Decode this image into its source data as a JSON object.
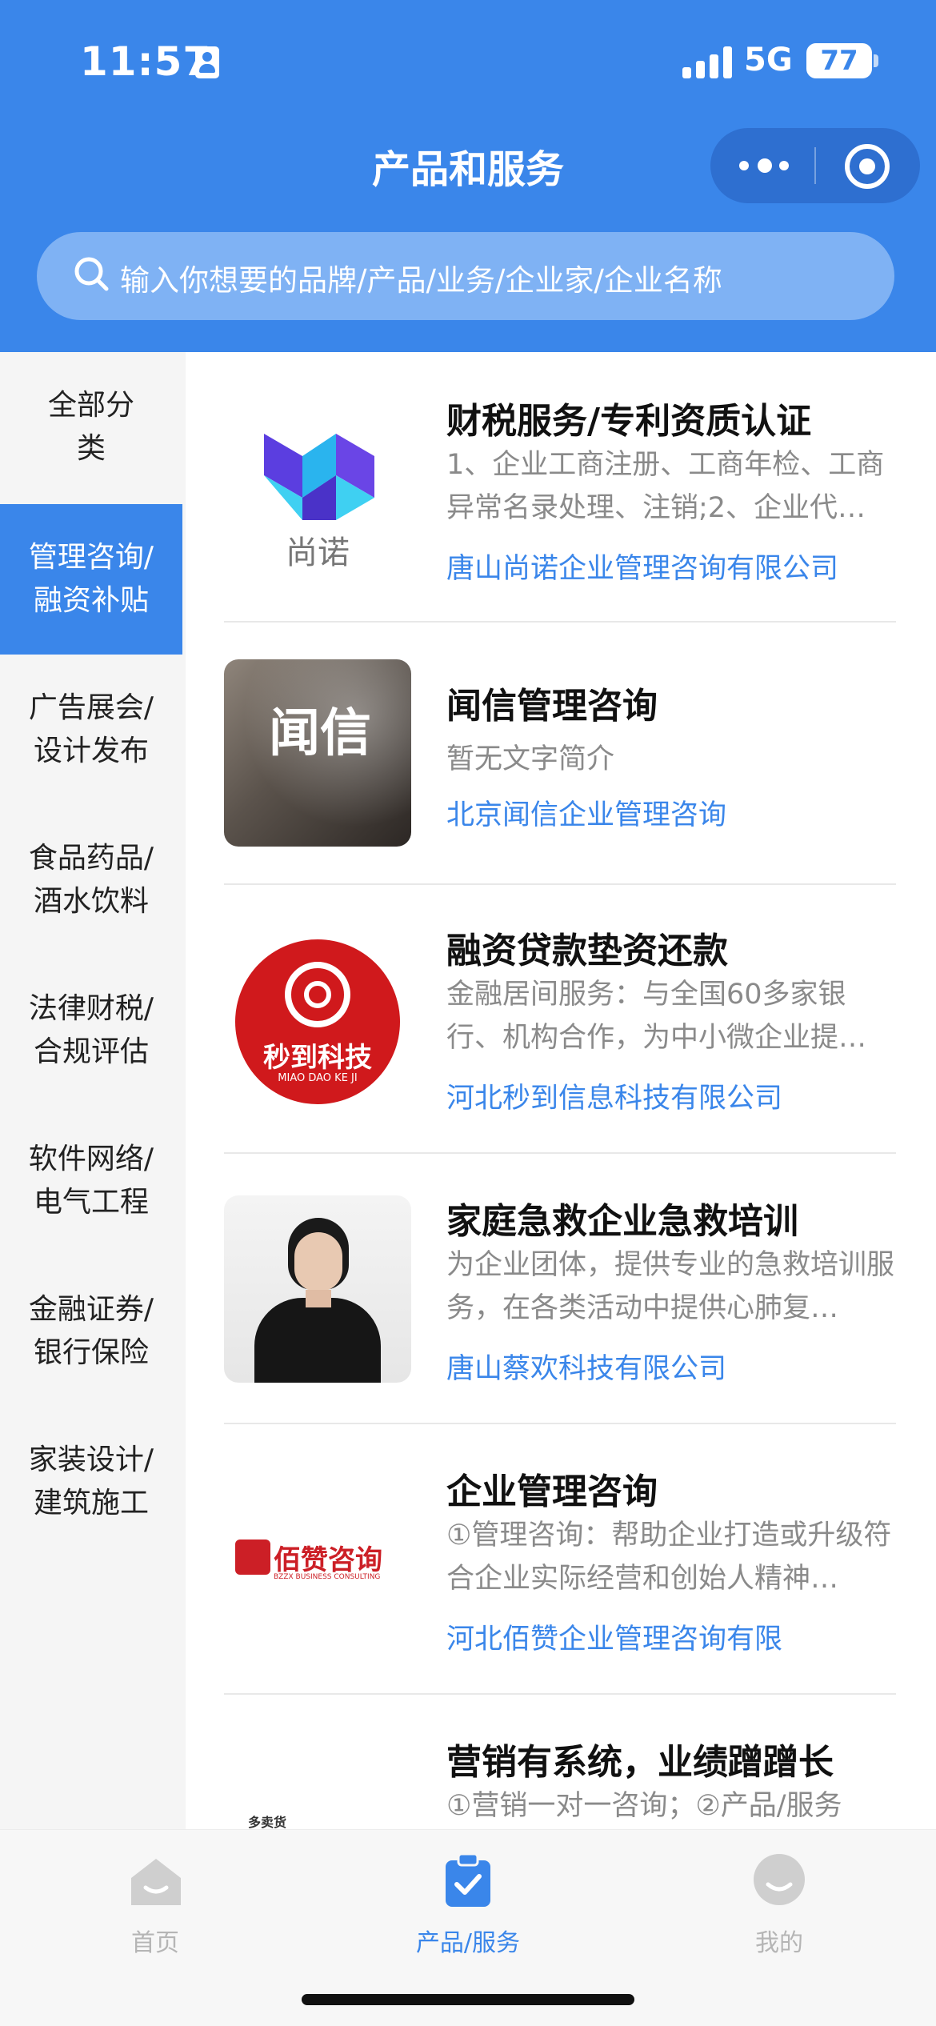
{
  "status_bar": {
    "time": "11:57",
    "network": "5G",
    "battery": "77"
  },
  "nav": {
    "title": "产品和服务"
  },
  "search": {
    "placeholder": "输入你想要的品牌/产品/业务/企业家/企业名称"
  },
  "sidebar": {
    "items": [
      {
        "label": "全部分类",
        "active": false
      },
      {
        "label": "管理咨询/融资补贴",
        "active": true
      },
      {
        "label": "广告展会/设计发布",
        "active": false
      },
      {
        "label": "食品药品/酒水饮料",
        "active": false
      },
      {
        "label": "法律财税/合规评估",
        "active": false
      },
      {
        "label": "软件网络/电气工程",
        "active": false
      },
      {
        "label": "金融证券/银行保险",
        "active": false
      },
      {
        "label": "家装设计/建筑施工",
        "active": false
      }
    ]
  },
  "products": [
    {
      "title": "财税服务/专利资质认证",
      "desc": "1、企业工商注册、工商年检、工商异常名录处理、注销;2、企业代…",
      "company": "唐山尚诺企业管理咨询有限公司",
      "logo_text": "尚诺"
    },
    {
      "title": "闻信管理咨询",
      "desc": "暂无文字简介",
      "company": "北京闻信企业管理咨询",
      "logo_text": "闻信"
    },
    {
      "title": "融资贷款垫资还款",
      "desc": "金融居间服务：与全国60多家银行、机构合作，为中小微企业提…",
      "company": "河北秒到信息科技有限公司",
      "logo_text": "秒到科技",
      "logo_subtext": "MIAO DAO KE JI"
    },
    {
      "title": "家庭急救企业急救培训",
      "desc": "为企业团体，提供专业的急救培训服务，在各类活动中提供心肺复…",
      "company": "唐山蔡欢科技有限公司"
    },
    {
      "title": "企业管理咨询",
      "desc": "①管理咨询：帮助企业打造或升级符合企业实际经营和创始人精神…",
      "company": "河北佰赞企业管理咨询有限",
      "logo_text": "佰赞咨询",
      "logo_subtext": "BZZX BUSINESS CONSULTING"
    },
    {
      "title": "营销有系统，业绩蹭蹭长",
      "desc": "①营销一对一咨询；②产品/服务",
      "company": "",
      "logo_text": "多卖货"
    }
  ],
  "tabbar": {
    "items": [
      {
        "label": "首页",
        "active": false
      },
      {
        "label": "产品/服务",
        "active": true
      },
      {
        "label": "我的",
        "active": false
      }
    ]
  },
  "colors": {
    "primary": "#3a86ea",
    "sidebar_bg": "#f5f5f5",
    "desc_gray": "#8a8a8a"
  }
}
